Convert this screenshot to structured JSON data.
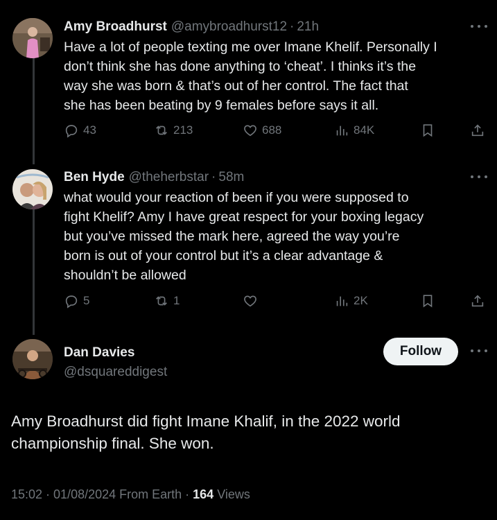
{
  "tweets": [
    {
      "name": "Amy Broadhurst",
      "handle": "@amybroadhurst12",
      "separator": "·",
      "time": "21h",
      "text": "Have a lot of people texting me over Imane Khelif. Personally I\ndon’t think she has done anything to ‘cheat’. I thinks it’s the\nway she was born & that’s out of her control. The fact that\nshe has been beating by 9 females before says it all.",
      "replies": "43",
      "reposts": "213",
      "likes": "688",
      "views": "84K"
    },
    {
      "name": "Ben Hyde",
      "handle": "@theherbstar",
      "separator": "·",
      "time": "58m",
      "text": "what would your reaction of been if you were supposed to\nfight Khelif? Amy I have great respect for your boxing legacy\nbut you’ve missed the mark here, agreed the way you’re\nborn is out of your control but it’s a clear advantage &\nshouldn’t be allowed",
      "replies": "5",
      "reposts": "1",
      "likes": "",
      "views": "2K"
    }
  ],
  "main": {
    "name": "Dan Davies",
    "handle": "@dsquareddigest",
    "follow_label": "Follow",
    "text": "Amy Broadhurst  did fight Imane Khalif, in the 2022 world\nchampionship final. She won.",
    "meta_prefix": "15:02 · 01/08/2024 From Earth · ",
    "views_count": "164",
    "views_label": " Views"
  },
  "icons": {
    "reply": "reply-icon",
    "repost": "repost-icon",
    "like": "heart-icon",
    "views": "views-icon",
    "bookmark": "bookmark-icon",
    "share": "share-icon",
    "more": "more-icon"
  },
  "colors": {
    "background": "#000000",
    "text": "#e7e9ea",
    "muted": "#71767b",
    "follow_bg": "#eff3f4"
  }
}
